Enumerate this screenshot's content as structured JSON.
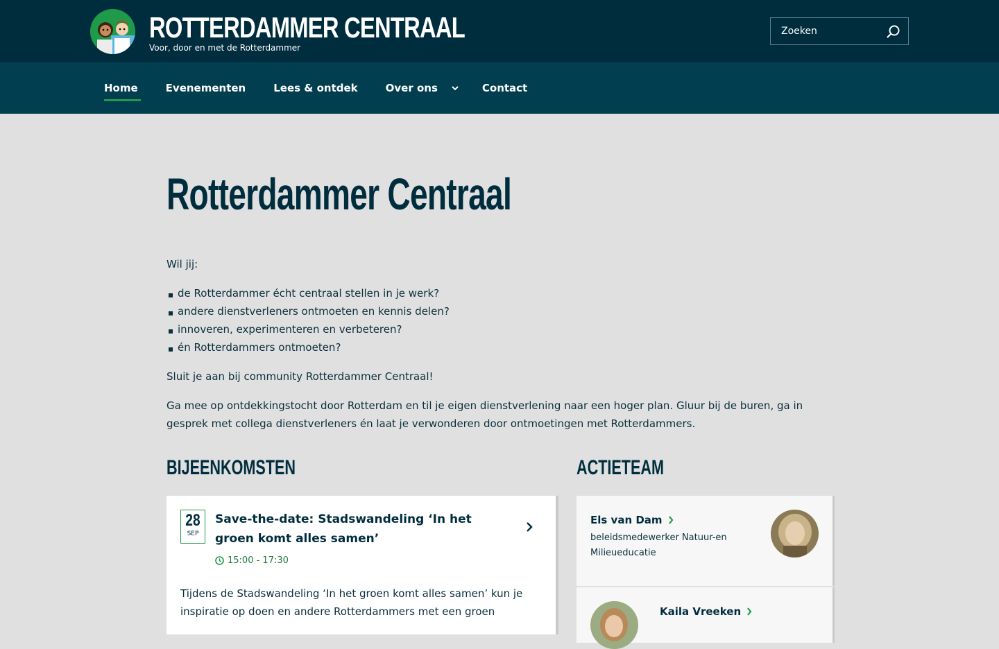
{
  "header": {
    "brand_title": "ROTTERDAMMER CENTRAAL",
    "brand_subtitle": "Voor, door en met de Rotterdammer",
    "logo_icon": "two-people-avatar-logo",
    "search_placeholder": "Zoeken",
    "search_icon": "search-icon"
  },
  "nav": {
    "items": [
      {
        "label": "Home",
        "active": true
      },
      {
        "label": "Evenementen"
      },
      {
        "label": "Lees & ontdek"
      },
      {
        "label": "Over ons",
        "has_dropdown": true
      },
      {
        "label": "Contact"
      }
    ]
  },
  "main": {
    "title": "Rotterdammer Centraal",
    "intro": "Wil jij:",
    "bullets": [
      "de Rotterdammer écht centraal stellen in je werk?",
      "andere dienstverleners ontmoeten en kennis delen?",
      "innoveren, experimenteren en verbeteren?",
      "én Rotterdammers ontmoeten?"
    ],
    "join_text": "Sluit je aan bij community Rotterdammer Centraal!",
    "body_text": "Ga mee op ontdekkingstocht door Rotterdam en til je eigen dienstverlening naar een hoger plan. Gluur bij de buren, ga in gesprek met collega dienstverleners én laat je verwonderen door ontmoetingen met Rotterdammers."
  },
  "events": {
    "heading": "BIJEENKOMSTEN",
    "items": [
      {
        "day": "28",
        "month": "SEP",
        "title": "Save-the-date: Stadswandeling ‘In het groen komt alles samen’",
        "time": "15:00 - 17:30",
        "description": "Tijdens de Stadswandeling ‘In het groen komt alles samen’ kun je inspiratie op doen en andere Rotterdammers met een groen"
      }
    ]
  },
  "team": {
    "heading": "ACTIETEAM",
    "members": [
      {
        "name": "Els van Dam",
        "role": "beleidsmedewerker Natuur-en Milieueducatie"
      },
      {
        "name": "Kaila Vreeken",
        "role": ""
      }
    ]
  },
  "colors": {
    "header_bg": "#002d3d",
    "nav_bg": "#003e50",
    "accent_green": "#1f9a4a",
    "page_bg": "#e0e0e0"
  }
}
